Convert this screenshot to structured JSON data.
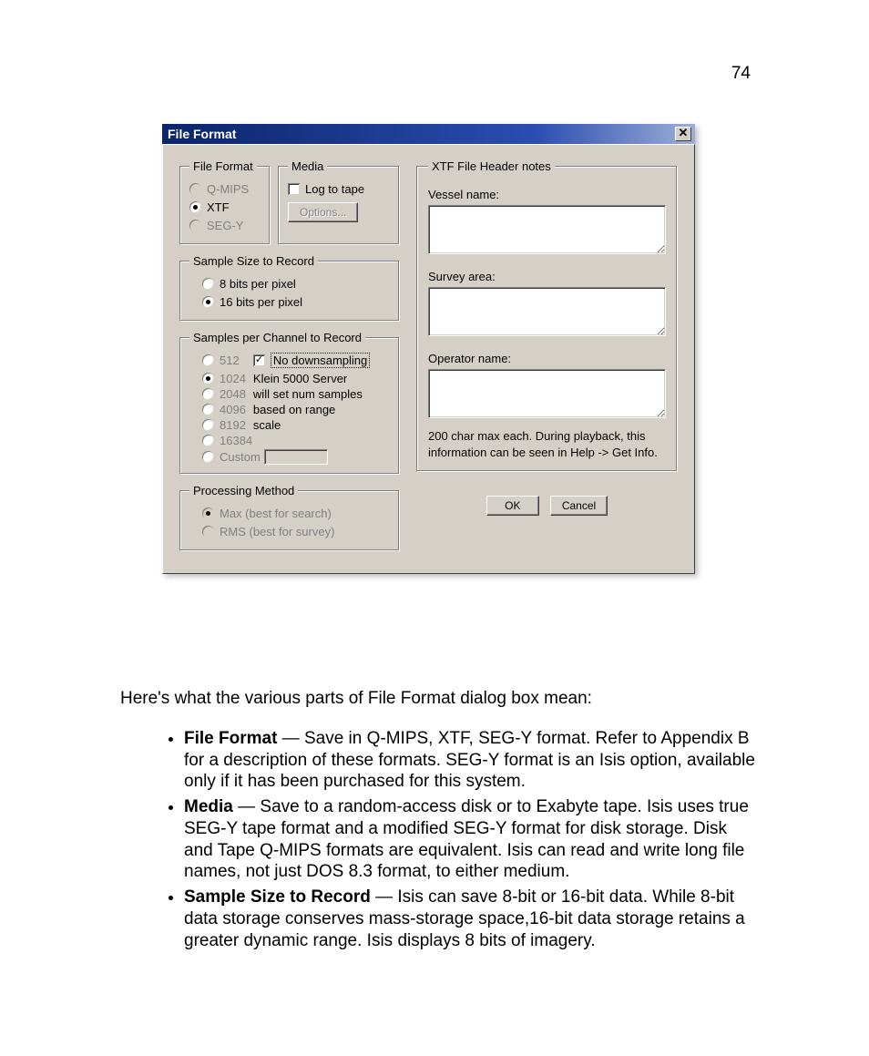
{
  "page": {
    "number": "74"
  },
  "dialog": {
    "title": "File Format",
    "close_glyph": "✕",
    "file_format": {
      "legend": "File Format",
      "options": {
        "qmips": "Q-MIPS",
        "xtf": "XTF",
        "segy": "SEG-Y"
      }
    },
    "media": {
      "legend": "Media",
      "log_to_tape": "Log to tape",
      "options_btn": "Options..."
    },
    "sample_size": {
      "legend": "Sample Size to Record",
      "bits8": "8 bits per pixel",
      "bits16": "16 bits per pixel"
    },
    "samples_per_channel": {
      "legend": "Samples per Channel to Record",
      "n512": "512",
      "n1024": "1024",
      "n2048": "2048",
      "n4096": "4096",
      "n8192": "8192",
      "n16384": "16384",
      "custom": "Custom",
      "no_downsampling": "No downsampling",
      "note1": "Klein 5000 Server",
      "note2": "will set num samples",
      "note3": "based on range",
      "note4": "scale"
    },
    "processing": {
      "legend": "Processing Method",
      "max": "Max (best for search)",
      "rms": "RMS (best for survey)"
    },
    "xtf": {
      "legend": "XTF File Header notes",
      "vessel_label": "Vessel name:",
      "survey_label": "Survey area:",
      "operator_label": "Operator name:",
      "hint": "200 char max each.  During playback, this information can be seen in Help -> Get Info."
    },
    "ok": "OK",
    "cancel": "Cancel"
  },
  "doc": {
    "intro": "Here's what the various parts of File Format dialog box mean:",
    "b1_term": "File Format",
    "b1_text": " — Save in Q-MIPS, XTF, SEG-Y format. Refer to Appendix B for a description of these formats. SEG-Y format is an Isis option, available only if it has been purchased for this system.",
    "b2_term": "Media",
    "b2_text": " — Save to a random-access disk or to Exabyte tape. Isis uses true SEG-Y tape format and a modified SEG-Y format for disk storage. Disk and Tape Q-MIPS formats are equivalent. Isis can read and write long file names, not just DOS 8.3 format, to either medium.",
    "b3_term": "Sample Size to Record",
    "b3_text": " — Isis can save 8-bit or 16-bit data. While 8-bit data storage conserves mass-storage space,16-bit data storage retains a greater dynamic range. Isis displays 8 bits of imagery."
  }
}
